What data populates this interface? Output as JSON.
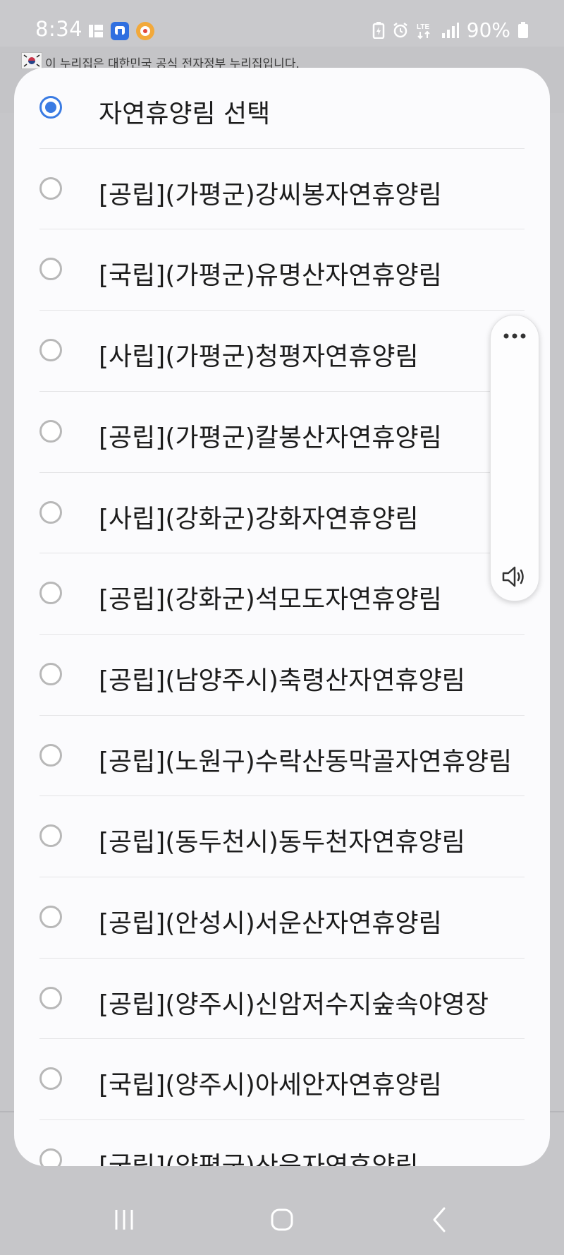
{
  "status_bar": {
    "time": "8:34",
    "battery": "90%",
    "network": "LTE"
  },
  "banner": {
    "text": "이 누리집은 대한민국 공식 전자정부 누리집입니다."
  },
  "dialog": {
    "options": [
      {
        "label": "자연휴양림 선택",
        "selected": true
      },
      {
        "label": "[공립](가평군)강씨봉자연휴양림",
        "selected": false
      },
      {
        "label": "[국립](가평군)유명산자연휴양림",
        "selected": false
      },
      {
        "label": "[사립](가평군)청평자연휴양림",
        "selected": false
      },
      {
        "label": "[공립](가평군)칼봉산자연휴양림",
        "selected": false
      },
      {
        "label": "[사립](강화군)강화자연휴양림",
        "selected": false
      },
      {
        "label": "[공립](강화군)석모도자연휴양림",
        "selected": false
      },
      {
        "label": "[공립](남양주시)축령산자연휴양림",
        "selected": false
      },
      {
        "label": "[공립](노원구)수락산동막골자연휴양림",
        "selected": false
      },
      {
        "label": "[공립](동두천시)동두천자연휴양림",
        "selected": false
      },
      {
        "label": "[공립](안성시)서운산자연휴양림",
        "selected": false
      },
      {
        "label": "[공립](양주시)신암저수지숲속야영장",
        "selected": false
      },
      {
        "label": "[국립](양주시)아세안자연휴양림",
        "selected": false
      },
      {
        "label": "[국립](양평군)산음자연휴양림",
        "selected": false
      }
    ]
  },
  "colors": {
    "accent": "#3a7be3",
    "dialog_bg": "#fbfbfd",
    "scrim": "#c9c9cc"
  }
}
